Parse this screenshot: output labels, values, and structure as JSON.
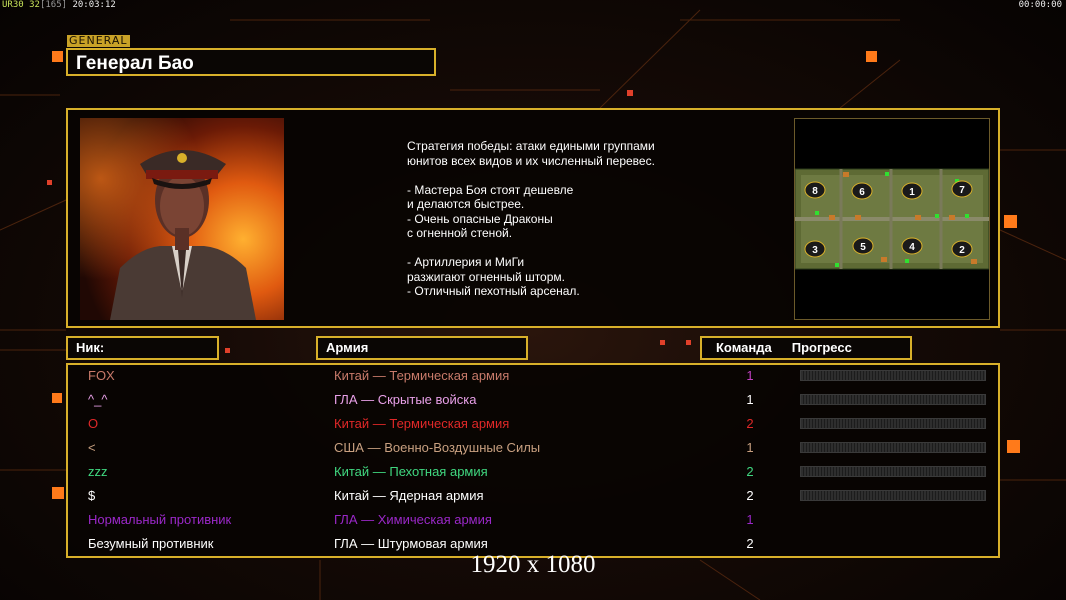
{
  "hud": {
    "ur_label": "UR",
    "fps_a": "30",
    "fps_b": "32",
    "bracket": "[165]",
    "clock": "20:03:12",
    "timer": "00:00:00"
  },
  "general": {
    "tag": "GENERAL",
    "name": "Генерал Бао"
  },
  "description": "Стратегия победы: атаки едиными группами\nюнитов всех видов и их численный перевес.\n\n- Мастера Боя стоят дешевле\nи делаются быстрее.\n- Очень опасные Драконы\nс огненной стеной.\n\n- Артиллерия и МиГи\nразжигают огненный шторм.\n- Отличный пехотный арсенал.",
  "map": {
    "slots": [
      "8",
      "6",
      "1",
      "7",
      "3",
      "5",
      "4",
      "2"
    ]
  },
  "headers": {
    "nick": "Ник:",
    "army": "Армия",
    "team": "Команда",
    "progress": "Прогресс"
  },
  "players": [
    {
      "nick": "FOX",
      "army": "Китай — Термическая армия",
      "team": "1",
      "color": "#c87a6a",
      "team_color": "#c040c0",
      "has_progress": true
    },
    {
      "nick": "^_^",
      "army": "ГЛА — Скрытые войска",
      "team": "1",
      "color": "#e8a0e8",
      "team_color": "#ffffff",
      "has_progress": true
    },
    {
      "nick": "O",
      "army": "Китай — Термическая армия",
      "team": "2",
      "color": "#e02828",
      "team_color": "#e02828",
      "has_progress": true
    },
    {
      "nick": "<",
      "army": "США — Военно-Воздушные Силы",
      "team": "1",
      "color": "#c8a080",
      "team_color": "#c8a080",
      "has_progress": true
    },
    {
      "nick": "zzz",
      "army": "Китай — Пехотная армия",
      "team": "2",
      "color": "#40d880",
      "team_color": "#40d880",
      "has_progress": true
    },
    {
      "nick": "$",
      "army": "Китай — Ядерная армия",
      "team": "2",
      "color": "#ffffff",
      "team_color": "#ffffff",
      "has_progress": true
    },
    {
      "nick": "Нормальный противник",
      "army": "ГЛА — Химическая армия",
      "team": "1",
      "color": "#9a28c8",
      "team_color": "#9a28c8",
      "has_progress": false
    },
    {
      "nick": "Безумный противник",
      "army": "ГЛА — Штурмовая армия",
      "team": "2",
      "color": "#ffffff",
      "team_color": "#ffffff",
      "has_progress": false
    }
  ],
  "resolution": "1920 x 1080",
  "colors": {
    "frame": "#d8b02a",
    "accent": "#ff7a1a"
  }
}
